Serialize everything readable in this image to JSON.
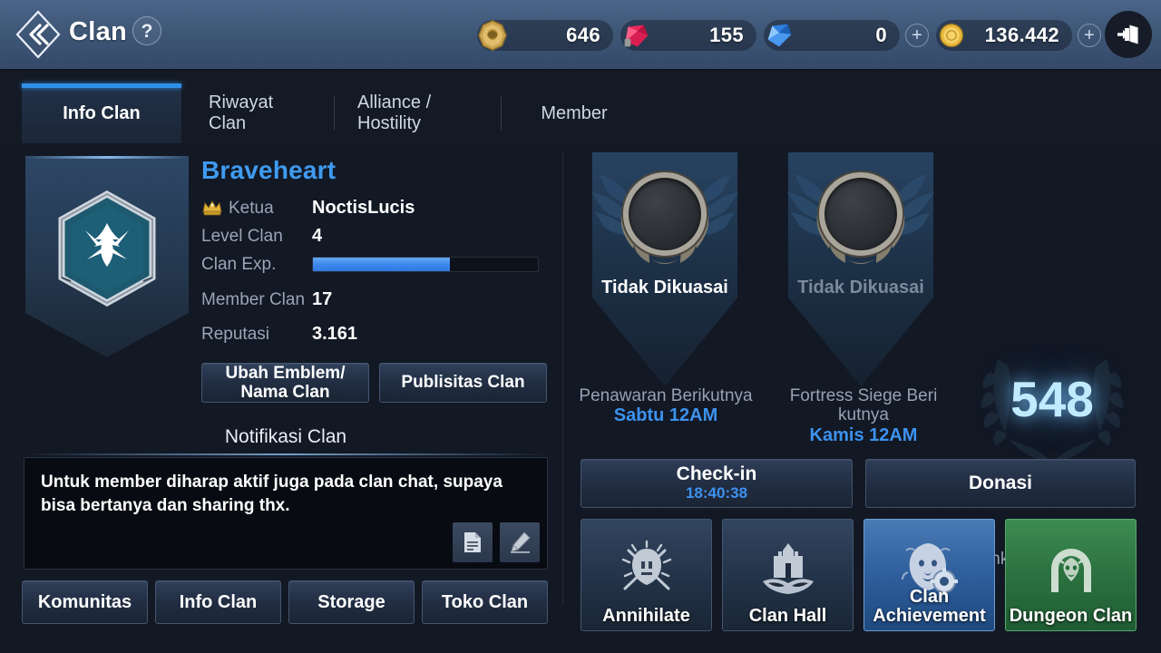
{
  "header": {
    "back_icon": "double-chevron-left-icon",
    "title": "Clan",
    "help_label": "?",
    "exit_icon": "exit-door-icon",
    "currencies": [
      {
        "icon": "lion-medallion-icon",
        "value": "646",
        "has_plus": false
      },
      {
        "icon": "red-gem-icon",
        "value": "155",
        "has_plus": false
      },
      {
        "icon": "blue-diamond-icon",
        "value": "0",
        "has_plus": true,
        "plus_label": "+"
      },
      {
        "icon": "gold-coin-icon",
        "value": "136.442",
        "has_plus": true,
        "plus_label": "+"
      }
    ]
  },
  "tabs": [
    {
      "label": "Info Clan",
      "active": true
    },
    {
      "label": "Riwayat Clan",
      "active": false
    },
    {
      "label": "Alliance / Hostility",
      "active": false
    },
    {
      "label": "Member",
      "active": false
    }
  ],
  "clan": {
    "emblem_icon": "clan-eagle-emblem-icon",
    "name": "Braveheart",
    "leader_icon": "gold-crown-icon",
    "leader_label": "Ketua",
    "leader_value": "NoctisLucis",
    "level_label": "Level Clan",
    "level_value": "4",
    "exp_label": "Clan Exp.",
    "exp_percent": 61,
    "member_label": "Member Clan",
    "member_value": "17",
    "reputation_label": "Reputasi",
    "reputation_value": "3.161",
    "edit_emblem_button": "Ubah Emblem/ Nama Clan",
    "publicity_button": "Publisitas Clan"
  },
  "notification": {
    "title": "Notifikasi Clan",
    "text": "Untuk member diharap aktif juga pada clan chat, supaya bisa bertanya dan sharing thx.",
    "copy_icon": "document-icon",
    "edit_icon": "pencil-icon"
  },
  "bottom_buttons": [
    {
      "label": "Komunitas"
    },
    {
      "label": "Info Clan"
    },
    {
      "label": "Storage"
    },
    {
      "label": "Toko Clan"
    }
  ],
  "territories": [
    {
      "status": "Tidak Dikuasai",
      "status_color": "#ffffff",
      "caption": "Penawaran Berikutnya",
      "time": "Sabtu 12AM"
    },
    {
      "status": "Tidak Dikuasai",
      "status_color": "#7d8a9b",
      "caption": "Fortress Siege Beri kutnya",
      "time": "Kamis 12AM"
    }
  ],
  "ranking": {
    "number": "548",
    "label": "Ranking Clan",
    "badge_icon": "ribbon-medal-icon"
  },
  "actions": {
    "checkin_label": "Check-in",
    "checkin_timer": "18:40:38",
    "donate_label": "Donasi"
  },
  "tiles": [
    {
      "label": "Annihilate",
      "icon": "helmet-swords-icon",
      "style": "dark"
    },
    {
      "label": "Clan Hall",
      "icon": "castle-icon",
      "style": "dark"
    },
    {
      "label": "Clan Achievement",
      "icon": "lion-gear-icon",
      "style": "blue"
    },
    {
      "label": "Dungeon Clan",
      "icon": "dungeon-gate-icon",
      "style": "green"
    }
  ],
  "colors": {
    "accent_blue": "#3d92ef",
    "clan_name_blue": "#3f9bf0",
    "rank_glow": "#bfeaff",
    "tile_blue": "#2f5f9c",
    "tile_green": "#2c7241"
  }
}
